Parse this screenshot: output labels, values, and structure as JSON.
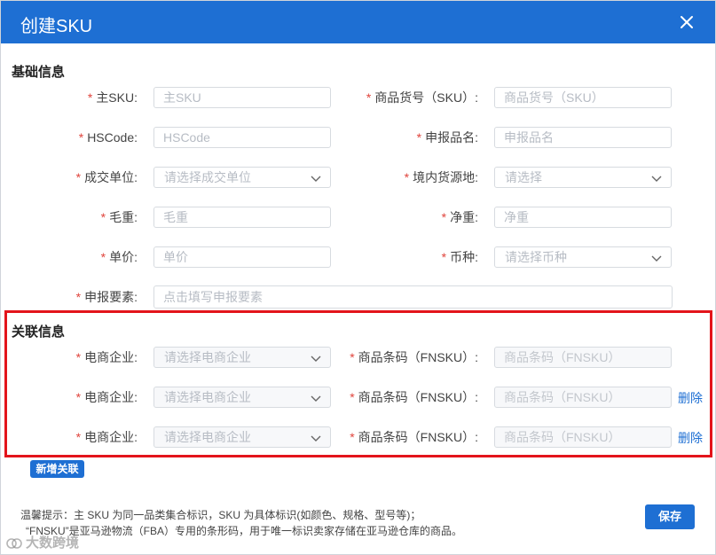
{
  "dialog": {
    "title": "创建SKU"
  },
  "basic": {
    "section_title": "基础信息",
    "sku": {
      "label": "主SKU:",
      "placeholder": "主SKU"
    },
    "item_no": {
      "label": "商品货号（SKU）:",
      "placeholder": "商品货号（SKU）"
    },
    "hscode": {
      "label": "HSCode:",
      "placeholder": "HSCode"
    },
    "declare_name": {
      "label": "申报品名:",
      "placeholder": "申报品名"
    },
    "deal_unit": {
      "label": "成交单位:",
      "placeholder": "请选择成交单位"
    },
    "origin": {
      "label": "境内货源地:",
      "placeholder": "请选择"
    },
    "gross_weight": {
      "label": "毛重:",
      "placeholder": "毛重"
    },
    "net_weight": {
      "label": "净重:",
      "placeholder": "净重"
    },
    "unit_price": {
      "label": "单价:",
      "placeholder": "单价"
    },
    "currency": {
      "label": "币种:",
      "placeholder": "请选择币种"
    },
    "declare_elements": {
      "label": "申报要素:",
      "placeholder": "点击填写申报要素"
    }
  },
  "related": {
    "section_title": "关联信息",
    "rows": [
      {
        "company_label": "电商企业:",
        "company_placeholder": "请选择电商企业",
        "fnsku_label": "商品条码（FNSKU）:",
        "fnsku_placeholder": "商品条码（FNSKU）"
      },
      {
        "company_label": "电商企业:",
        "company_placeholder": "请选择电商企业",
        "fnsku_label": "商品条码（FNSKU）:",
        "fnsku_placeholder": "商品条码（FNSKU）",
        "delete_label": "删除"
      },
      {
        "company_label": "电商企业:",
        "company_placeholder": "请选择电商企业",
        "fnsku_label": "商品条码（FNSKU）:",
        "fnsku_placeholder": "商品条码（FNSKU）",
        "delete_label": "删除"
      }
    ],
    "add_label": "新增关联"
  },
  "footer": {
    "tip_line1": "温馨提示：主 SKU 为同一品类集合标识，SKU 为具体标识(如颜色、规格、型号等)；",
    "tip_line2": "“FNSKU”是亚马逊物流（FBA）专用的条形码，用于唯一标识卖家存储在亚马逊仓库的商品。",
    "save_label": "保存"
  },
  "watermark": {
    "text": "大数跨境"
  },
  "icons": {
    "close": "close-icon",
    "dropdown": "chevron-down-icon"
  },
  "colors": {
    "primary": "#1e6fd3",
    "required": "#e0443c",
    "highlight": "#e3141b"
  }
}
